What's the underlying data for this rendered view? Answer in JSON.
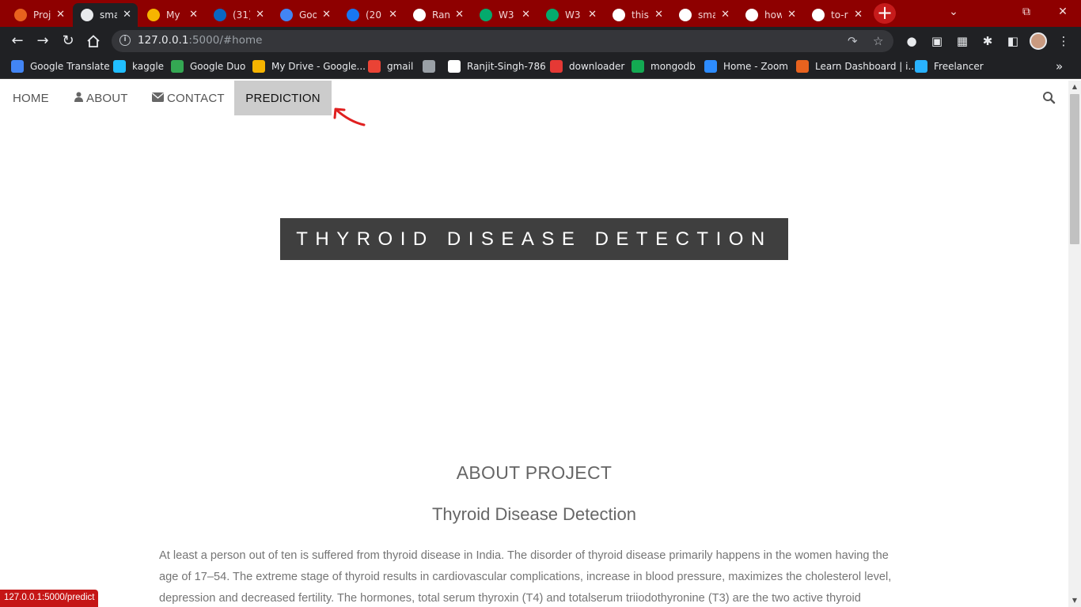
{
  "browser": {
    "tabs": [
      {
        "title": "Proj",
        "favicon": "orange-circle-icon",
        "color": "#e8621e"
      },
      {
        "title": "sma",
        "favicon": "globe-icon",
        "color": "#e8eaed",
        "active": true
      },
      {
        "title": "My",
        "favicon": "google-drive-icon",
        "color": "#f6b400"
      },
      {
        "title": "(31)",
        "favicon": "linkedin-icon",
        "color": "#0a66c2"
      },
      {
        "title": "Goo",
        "favicon": "google-translate-icon",
        "color": "#4285f4"
      },
      {
        "title": "(20",
        "favicon": "facebook-icon",
        "color": "#1877f2"
      },
      {
        "title": "Ran",
        "favicon": "github-icon",
        "color": "#ffffff"
      },
      {
        "title": "W3",
        "favicon": "w3schools-icon",
        "color": "#04aa6d"
      },
      {
        "title": "W3",
        "favicon": "w3schools-icon",
        "color": "#04aa6d"
      },
      {
        "title": "this",
        "favicon": "globe-icon",
        "color": "#ffffff"
      },
      {
        "title": "sma",
        "favicon": "globe-icon",
        "color": "#ffffff"
      },
      {
        "title": "how",
        "favicon": "google-icon",
        "color": "#ffffff"
      },
      {
        "title": "to-r",
        "favicon": "cube-icon",
        "color": "#ffffff"
      }
    ],
    "url_host": "127.0.0.1",
    "url_path": ":5000/#home",
    "bookmarks": [
      {
        "label": "Google Translate",
        "icon": "google-translate-icon",
        "color": "#4285f4"
      },
      {
        "label": "kaggle",
        "icon": "kaggle-icon",
        "color": "#20beff"
      },
      {
        "label": "Google Duo",
        "icon": "google-duo-icon",
        "color": "#34a853"
      },
      {
        "label": "My Drive - Google...",
        "icon": "google-drive-icon",
        "color": "#f6b400"
      },
      {
        "label": "gmail",
        "icon": "gmail-icon",
        "color": "#ea4335"
      },
      {
        "label": "",
        "icon": "globe-icon",
        "color": "#9aa0a6"
      },
      {
        "label": "Ranjit-Singh-786",
        "icon": "github-icon",
        "color": "#ffffff"
      },
      {
        "label": "downloader",
        "icon": "download-icon",
        "color": "#e53935"
      },
      {
        "label": "mongodb",
        "icon": "mongodb-leaf-icon",
        "color": "#13aa52"
      },
      {
        "label": "Home - Zoom",
        "icon": "zoom-icon",
        "color": "#2d8cff"
      },
      {
        "label": "Learn Dashboard | i...",
        "icon": "orange-circle-icon",
        "color": "#e8621e"
      },
      {
        "label": "Freelancer",
        "icon": "freelancer-icon",
        "color": "#29b2fe"
      }
    ]
  },
  "site": {
    "nav": {
      "home": "HOME",
      "about": "ABOUT",
      "contact": "CONTACT",
      "prediction": "PREDICTION"
    },
    "hero_title": "THYROID DISEASE DETECTION",
    "about": {
      "heading": "ABOUT PROJECT",
      "subheading": "Thyroid Disease Detection",
      "body": "At least a person out of ten is suffered from thyroid disease in India. The disorder of thyroid disease primarily happens in the women having the age of 17–54. The extreme stage of thyroid results in cardiovascular complications, increase in blood pressure, maximizes the cholesterol level, depression and decreased fertility. The hormones, total serum thyroxin (T4) and totalserum triiodothyronine (T3) are the two active thyroid"
    }
  },
  "status_bar": "127.0.0.1:5000/predict",
  "colors": {
    "tabstrip": "#8e0000",
    "chrome_dark": "#202124",
    "hero_bg": "#3f3f3f",
    "nav_highlight": "#cccccc",
    "annotation_arrow": "#e02020"
  }
}
